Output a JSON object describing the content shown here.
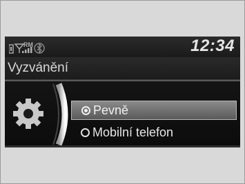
{
  "status": {
    "clock": "12:34",
    "signal_label": "RM",
    "icons": [
      "phone-icon",
      "signal-icon",
      "bluetooth-icon"
    ]
  },
  "header": {
    "title": "Vyzvánění"
  },
  "options": [
    {
      "label": "Pevně",
      "selected": true
    },
    {
      "label": "Mobilní telefon",
      "selected": false
    }
  ],
  "colors": {
    "screen_bg": "#0a0a0a",
    "highlight": "#7a7a7a",
    "text": "#f0f0f0"
  }
}
